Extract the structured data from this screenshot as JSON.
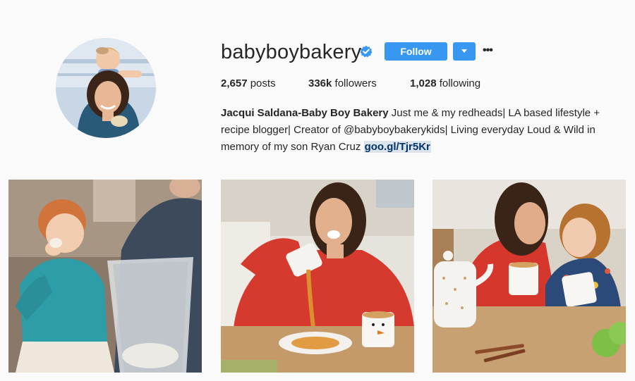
{
  "profile": {
    "username": "babyboybakery",
    "verified": true,
    "follow_label": "Follow",
    "more_label": "•••",
    "avatar_icon": "profile-photo"
  },
  "stats": {
    "posts_count": "2,657",
    "posts_label": "posts",
    "followers_count": "336k",
    "followers_label": "followers",
    "following_count": "1,028",
    "following_label": "following"
  },
  "bio": {
    "full_name": "Jacqui Saldana-Baby Boy Bakery",
    "text": " Just me & my redheads| LA based lifestyle + recipe blogger| Creator of @babyboybakerykids| Living everyday Loud & Wild in memory of my son Ryan Cruz ",
    "link": "goo.gl/Tjr5Kr"
  },
  "colors": {
    "accent": "#3897f0",
    "background": "#fafafa",
    "text": "#262626",
    "link": "#003569"
  },
  "posts": [
    {
      "type": "photo"
    },
    {
      "type": "photo"
    },
    {
      "type": "photo"
    }
  ]
}
